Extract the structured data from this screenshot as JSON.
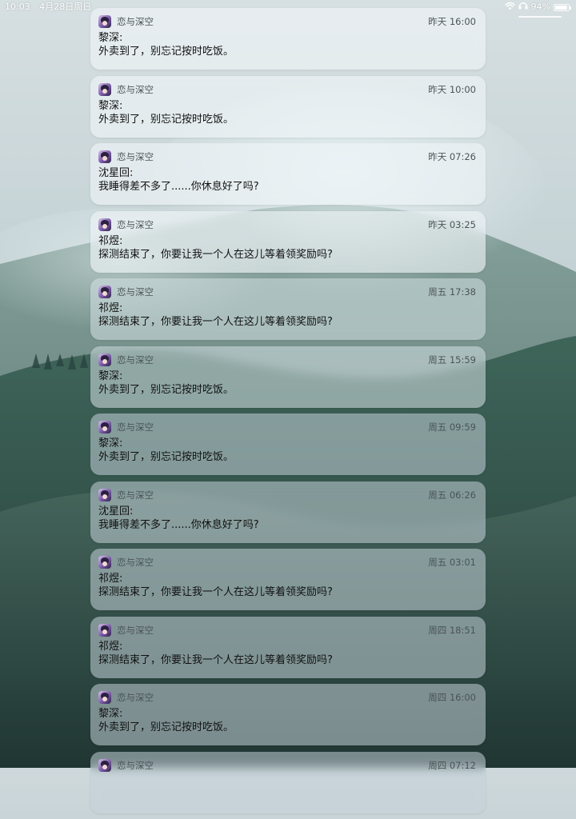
{
  "status_bar": {
    "time": "10:03",
    "date": "4月28日周日",
    "battery": "94%",
    "battery_level": 0.94,
    "icons": [
      "wifi-icon",
      "headphones-icon",
      "battery-icon"
    ]
  },
  "notifications": [
    {
      "app": "恋与深空",
      "time": "昨天 16:00",
      "sender": "黎深:",
      "message": "外卖到了，别忘记按时吃饭。"
    },
    {
      "app": "恋与深空",
      "time": "昨天 10:00",
      "sender": "黎深:",
      "message": "外卖到了，别忘记按时吃饭。"
    },
    {
      "app": "恋与深空",
      "time": "昨天 07:26",
      "sender": "沈星回:",
      "message": "我睡得差不多了......你休息好了吗?"
    },
    {
      "app": "恋与深空",
      "time": "昨天 03:25",
      "sender": "祁煜:",
      "message": "探测结束了，你要让我一个人在这儿等着领奖励吗?"
    },
    {
      "app": "恋与深空",
      "time": "周五 17:38",
      "sender": "祁煜:",
      "message": "探测结束了，你要让我一个人在这儿等着领奖励吗?"
    },
    {
      "app": "恋与深空",
      "time": "周五 15:59",
      "sender": "黎深:",
      "message": "外卖到了，别忘记按时吃饭。"
    },
    {
      "app": "恋与深空",
      "time": "周五 09:59",
      "sender": "黎深:",
      "message": "外卖到了，别忘记按时吃饭。"
    },
    {
      "app": "恋与深空",
      "time": "周五 06:26",
      "sender": "沈星回:",
      "message": "我睡得差不多了......你休息好了吗?"
    },
    {
      "app": "恋与深空",
      "time": "周五 03:01",
      "sender": "祁煜:",
      "message": "探测结束了，你要让我一个人在这儿等着领奖励吗?"
    },
    {
      "app": "恋与深空",
      "time": "周四 18:51",
      "sender": "祁煜:",
      "message": "探测结束了，你要让我一个人在这儿等着领奖励吗?"
    },
    {
      "app": "恋与深空",
      "time": "周四 16:00",
      "sender": "黎深:",
      "message": "外卖到了，别忘记按时吃饭。"
    },
    {
      "app": "恋与深空",
      "time": "周四 07:12",
      "sender": "",
      "message": ""
    }
  ]
}
